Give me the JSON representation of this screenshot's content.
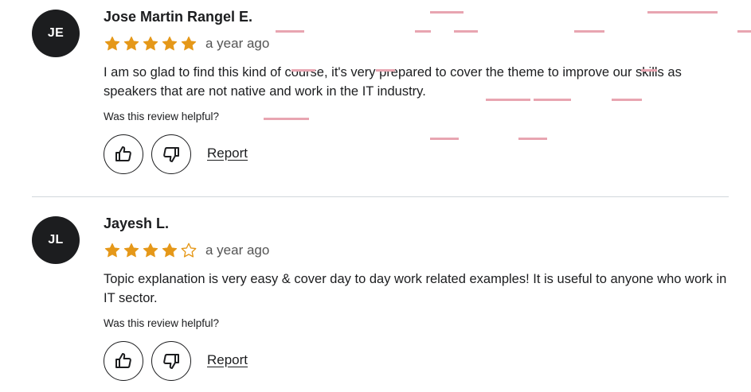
{
  "colors": {
    "star": "#e59819",
    "avatar_bg": "#1c1d1f",
    "text": "#1c1d1f",
    "muted": "#545454",
    "divider": "#d1d7dc",
    "annotation_marks": "#e8a5b1"
  },
  "reviews": [
    {
      "initials": "JE",
      "name": "Jose Martin Rangel E.",
      "rating": 5,
      "time": "a year ago",
      "body": "I am so glad to find this kind of course, it's very prepared to cover the theme to improve our skills as speakers that are not native and work in the IT industry.",
      "helpful_prompt": "Was this review helpful?",
      "upvote_icon": "thumbs-up-icon",
      "downvote_icon": "thumbs-down-icon",
      "report_label": "Report"
    },
    {
      "initials": "JL",
      "name": "Jayesh L.",
      "rating": 4,
      "time": "a year ago",
      "body": "Topic explanation is very easy & cover day to day work related examples! It is useful to anyone who work in IT sector.",
      "helpful_prompt": "Was this review helpful?",
      "upvote_icon": "thumbs-up-icon",
      "downvote_icon": "thumbs-down-icon",
      "report_label": "Report"
    }
  ]
}
